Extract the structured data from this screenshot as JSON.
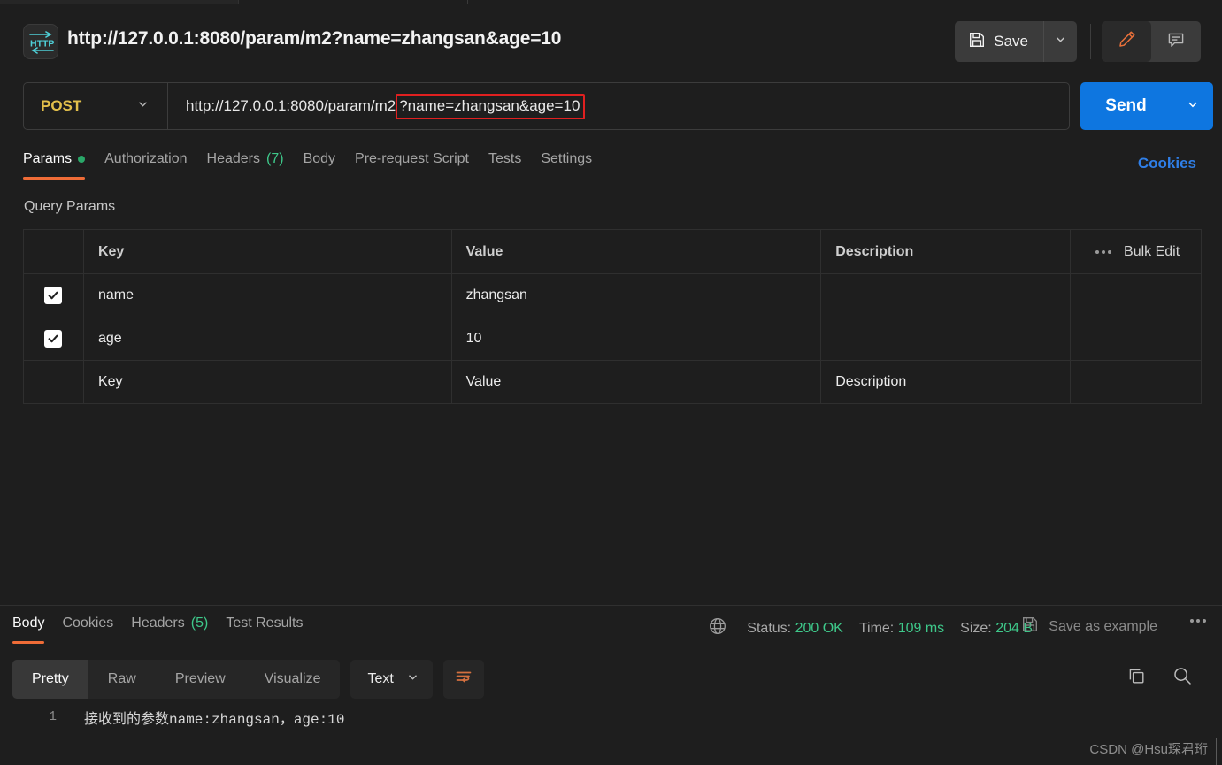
{
  "window": {
    "title": "http://127.0.0.1:8080/param/m2?name=zhangsan&age=10",
    "http_icon_label": "HTTP"
  },
  "toolbar": {
    "save_label": "Save",
    "save_icon": "floppy-disk-icon",
    "save_caret_icon": "chevron-down-icon",
    "edit_icon": "pencil-icon",
    "comment_icon": "comment-icon"
  },
  "url_bar": {
    "method": "POST",
    "method_caret_icon": "chevron-down-icon",
    "url_base": "http://127.0.0.1:8080/param/m2",
    "url_query_highlighted": "?name=zhangsan&age=10",
    "highlight_color": "#e02020",
    "send_label": "Send",
    "send_caret_icon": "chevron-down-icon",
    "send_color": "#0e76e0"
  },
  "request_tabs": {
    "items": [
      {
        "label": "Params",
        "badge": "",
        "dot": true,
        "active": true
      },
      {
        "label": "Authorization",
        "badge": "",
        "dot": false,
        "active": false
      },
      {
        "label": "Headers",
        "badge": "(7)",
        "dot": false,
        "active": false
      },
      {
        "label": "Body",
        "badge": "",
        "dot": false,
        "active": false
      },
      {
        "label": "Pre-request Script",
        "badge": "",
        "dot": false,
        "active": false
      },
      {
        "label": "Tests",
        "badge": "",
        "dot": false,
        "active": false
      },
      {
        "label": "Settings",
        "badge": "",
        "dot": false,
        "active": false
      }
    ],
    "cookies_label": "Cookies",
    "active_underline_color": "#ef6c37",
    "dot_color": "#2aa869",
    "badge_color": "#3ec88a",
    "cookies_color": "#2f7fe8"
  },
  "query_params": {
    "section_label": "Query Params",
    "columns": [
      "Key",
      "Value",
      "Description"
    ],
    "bulk_edit_label": "Bulk Edit",
    "bulk_more_icon": "ellipsis-icon",
    "rows": [
      {
        "checked": true,
        "key": "name",
        "value": "zhangsan",
        "description": ""
      },
      {
        "checked": true,
        "key": "age",
        "value": "10",
        "description": ""
      }
    ],
    "placeholder_row": {
      "key": "Key",
      "value": "Value",
      "description": "Description"
    }
  },
  "response": {
    "tabs": [
      {
        "label": "Body",
        "badge": "",
        "active": true
      },
      {
        "label": "Cookies",
        "badge": "",
        "active": false
      },
      {
        "label": "Headers",
        "badge": "(5)",
        "active": false
      },
      {
        "label": "Test Results",
        "badge": "",
        "active": false
      }
    ],
    "globe_icon": "globe-icon",
    "status_label": "Status:",
    "status_value": "200 OK",
    "time_label": "Time:",
    "time_value": "109 ms",
    "size_label": "Size:",
    "size_value": "204 B",
    "save_example_label": "Save as example",
    "save_example_icon": "floppy-disk-icon",
    "more_icon": "ellipsis-icon",
    "value_color": "#3ec88a"
  },
  "body_toolbar": {
    "views": [
      {
        "label": "Pretty",
        "active": true
      },
      {
        "label": "Raw",
        "active": false
      },
      {
        "label": "Preview",
        "active": false
      },
      {
        "label": "Visualize",
        "active": false
      }
    ],
    "format": "Text",
    "format_caret_icon": "chevron-down-icon",
    "wrap_icon": "wrap-lines-icon",
    "copy_icon": "copy-icon",
    "search_icon": "search-icon",
    "wrap_icon_color": "#d4703f"
  },
  "body_content": {
    "line_number": "1",
    "text": "接收到的参数name:zhangsan，age:10"
  },
  "watermark": "CSDN @Hsu琛君珩"
}
